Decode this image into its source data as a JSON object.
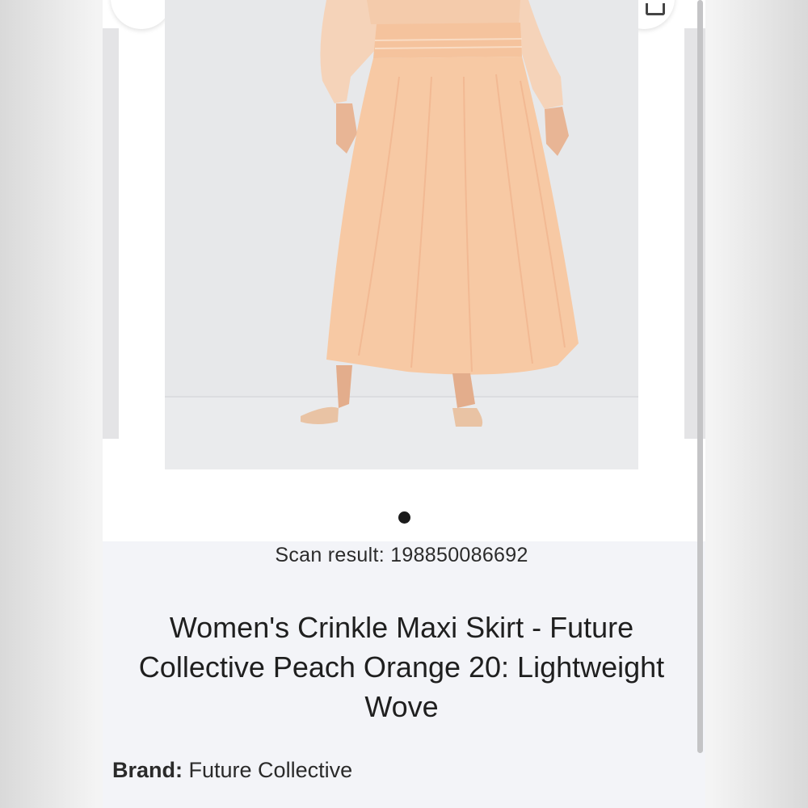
{
  "product": {
    "scan_label": "Scan result: 198850086692",
    "title": "Women's Crinkle Maxi Skirt - Future Collective Peach Orange 20: Lightweight Wove",
    "brand_key": "Brand:",
    "brand_value": "Future Collective",
    "colors": {
      "skirt": "#f7c9a4",
      "blouse": "#f5cba9",
      "heart": "#d23a2f"
    }
  },
  "carousel": {
    "active_index": 1,
    "total": 1
  },
  "icons": [
    "favorite-heart-icon",
    "share-icon",
    "cart-icon",
    "bag-icon"
  ]
}
